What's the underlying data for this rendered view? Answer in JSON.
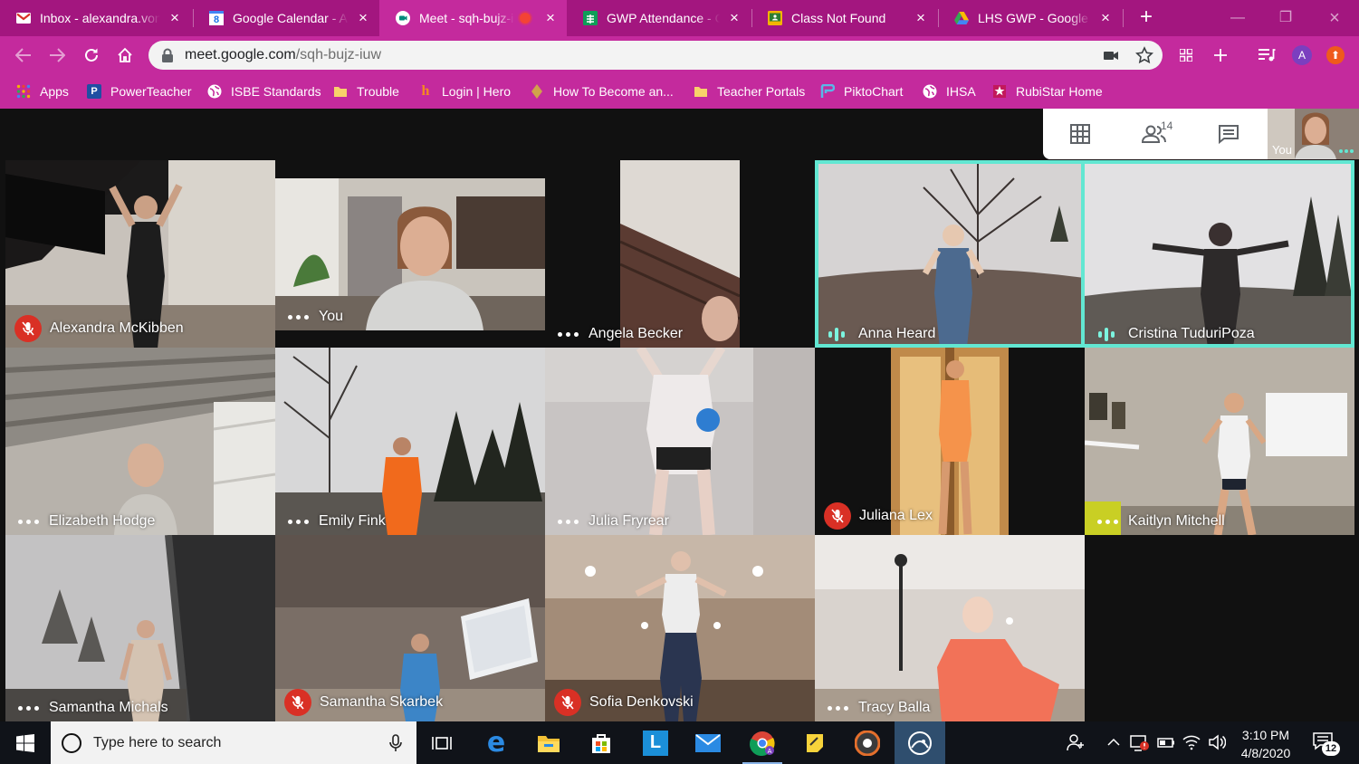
{
  "browser": {
    "tabs": [
      {
        "title": "Inbox - alexandra.von",
        "icon": "gmail-icon"
      },
      {
        "title": "Google Calendar - Apr",
        "icon": "calendar-icon",
        "icon_text": "8"
      },
      {
        "title": "Meet - sqh-bujz-iuw",
        "icon": "meet-icon",
        "active": true,
        "recording": true
      },
      {
        "title": "GWP Attendance - Goo",
        "icon": "sheets-icon"
      },
      {
        "title": "Class Not Found",
        "icon": "classroom-icon"
      },
      {
        "title": "LHS GWP - Google Drive",
        "icon": "drive-icon"
      }
    ],
    "url": "meet.google.com/sqh-bujz-iuw",
    "url_host": "meet.google.com",
    "url_path": "/sqh-bujz-iuw",
    "profile_initial": "A",
    "bookmarks": [
      {
        "label": "Apps",
        "icon": "apps-grid-icon"
      },
      {
        "label": "PowerTeacher",
        "icon": "powerteacher-icon",
        "icon_text": "P"
      },
      {
        "label": "ISBE Standards",
        "icon": "globe-icon"
      },
      {
        "label": "Trouble",
        "icon": "folder-icon"
      },
      {
        "label": "Login | Hero",
        "icon": "hero-icon",
        "icon_text": "h"
      },
      {
        "label": "How To Become an...",
        "icon": "diamond-icon"
      },
      {
        "label": "Teacher Portals",
        "icon": "folder-icon"
      },
      {
        "label": "PiktoChart",
        "icon": "piktochart-icon"
      },
      {
        "label": "IHSA",
        "icon": "globe-icon"
      },
      {
        "label": "RubiStar Home",
        "icon": "rubistar-icon"
      }
    ]
  },
  "meet": {
    "participant_count": "14",
    "self_label": "You",
    "participants": [
      {
        "name": "Alexandra McKibben",
        "status": "muted"
      },
      {
        "name": "You",
        "status": "idle"
      },
      {
        "name": "Angela Becker",
        "status": "idle"
      },
      {
        "name": "Anna Heard",
        "status": "speaking"
      },
      {
        "name": "Cristina TuduriPoza",
        "status": "speaking"
      },
      {
        "name": "Elizabeth Hodge",
        "status": "idle"
      },
      {
        "name": "Emily Fink",
        "status": "idle"
      },
      {
        "name": "Julia Fryrear",
        "status": "idle"
      },
      {
        "name": "Juliana Lex",
        "status": "muted"
      },
      {
        "name": "Kaitlyn Mitchell",
        "status": "idle"
      },
      {
        "name": "Samantha Michals",
        "status": "idle"
      },
      {
        "name": "Samantha Skarbek",
        "status": "muted"
      },
      {
        "name": "Sofia Denkovski",
        "status": "muted"
      },
      {
        "name": "Tracy Balla",
        "status": "idle"
      }
    ],
    "colors": {
      "speaking": "#62e7d2",
      "muted": "#d93025",
      "chrome_theme": "#c42a9d"
    }
  },
  "taskbar": {
    "search_placeholder": "Type here to search",
    "time": "3:10 PM",
    "date": "4/8/2020",
    "notification_count": "12"
  }
}
